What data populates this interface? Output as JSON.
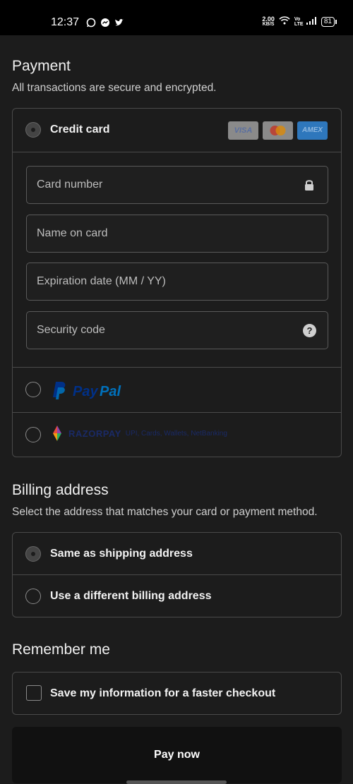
{
  "status_bar": {
    "time": "12:37",
    "net_speed_value": "2.00",
    "net_speed_unit": "KB/S",
    "volte": "Vo LTE",
    "battery": "81"
  },
  "payment": {
    "title": "Payment",
    "subtitle": "All transactions are secure and encrypted.",
    "credit_card_label": "Credit card",
    "card_brands": [
      "VISA",
      "mastercard",
      "AMEX"
    ],
    "fields": {
      "card_number": "Card number",
      "name_on_card": "Name on card",
      "expiration": "Expiration date (MM / YY)",
      "security_code": "Security code"
    },
    "paypal_label": "PayPal",
    "third_option_brand": "RAZORPAY",
    "third_option_text": "UPI, Cards, Wallets, NetBanking"
  },
  "billing": {
    "title": "Billing address",
    "subtitle": "Select the address that matches your card or payment method.",
    "options": [
      "Same as shipping address",
      "Use a different billing address"
    ]
  },
  "remember": {
    "title": "Remember me",
    "checkbox_label": "Save my information for a faster checkout"
  },
  "pay_button": "Pay now",
  "colors": {
    "background": "#1c1c1c",
    "paypal_dark": "#003087",
    "paypal_light": "#0070ba",
    "amex_blue": "#2e77bc"
  }
}
